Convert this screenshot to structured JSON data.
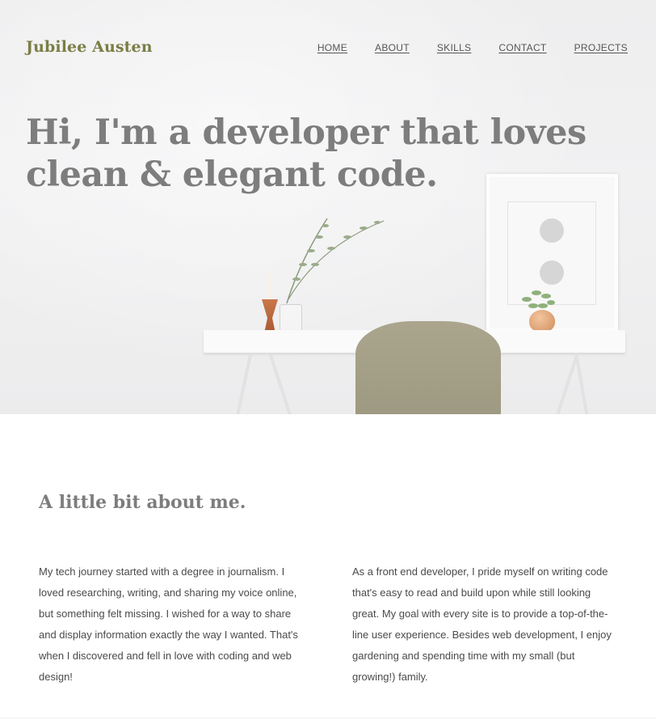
{
  "header": {
    "brand": "Jubilee Austen",
    "nav": [
      "HOME",
      "ABOUT",
      "SKILLS",
      "CONTACT",
      "PROJECTS"
    ]
  },
  "hero": {
    "headline": "Hi, I'm a developer that loves clean & elegant code."
  },
  "about": {
    "title": "A little bit about me.",
    "paragraph_left": "My tech journey started with a degree in journalism. I loved researching, writing, and sharing my voice online, but something felt missing. I wished for a way to share and display information exactly the way I wanted. That's when I discovered and fell in love with coding and web design!",
    "paragraph_right": "As a front end developer, I pride myself on writing code that's easy to read and build upon while still looking great. My goal with every site is to provide a top-of-the-line user experience. Besides web development, I enjoy gardening and spending time with my small (but growing!) family."
  },
  "colors": {
    "brand": "#7a7e45",
    "headline": "#7d7d7d",
    "chair": "#a39e86"
  }
}
